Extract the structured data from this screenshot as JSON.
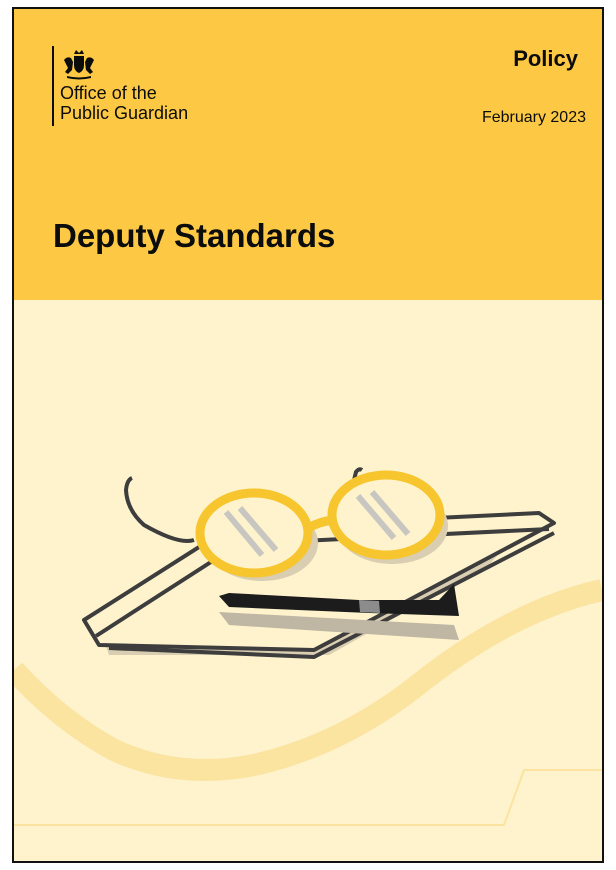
{
  "cover": {
    "org_name_line1": "Office of the",
    "org_name_line2": "Public Guardian",
    "doc_type": "Policy",
    "date": "February 2023",
    "title": "Deputy Standards"
  },
  "colors": {
    "header_yellow": "#fdc944",
    "cream_background": "#fef3cd",
    "glasses_yellow": "#f7c52d",
    "text_black": "#0b0c0c"
  },
  "icons": [
    "royal-coat-of-arms-icon"
  ]
}
